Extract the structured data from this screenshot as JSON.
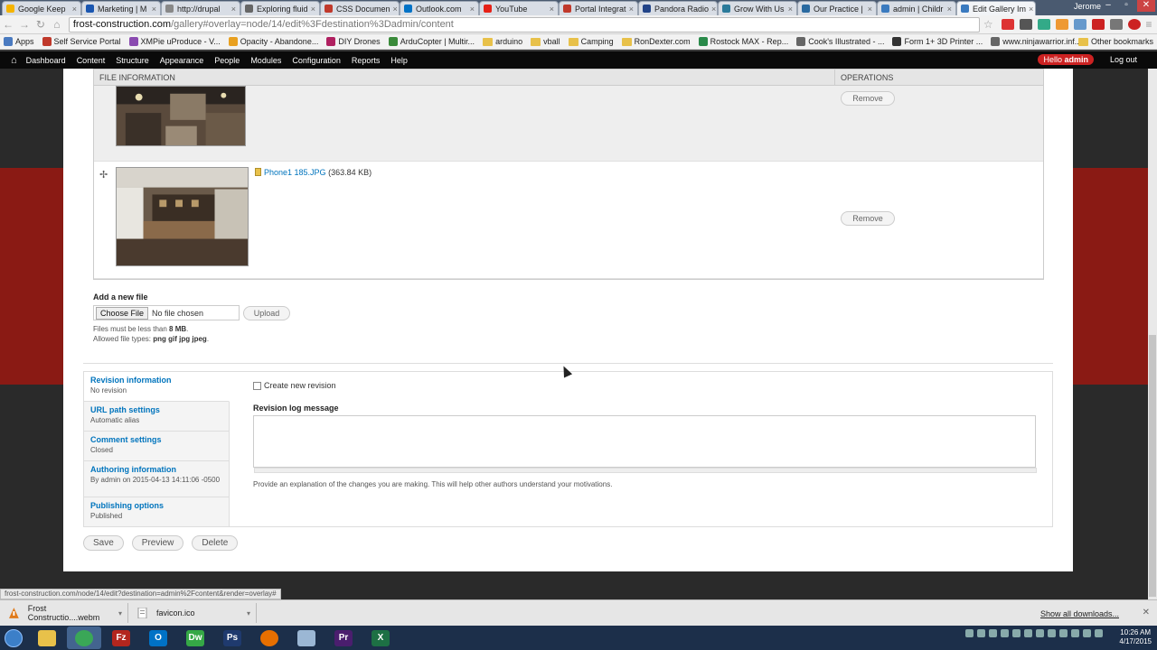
{
  "tabs": [
    {
      "label": "Google Keep",
      "color": "#f5b400"
    },
    {
      "label": "Marketing | M",
      "color": "#1a56b0"
    },
    {
      "label": "http://drupal",
      "color": "#888888"
    },
    {
      "label": "Exploring fluid",
      "color": "#666666"
    },
    {
      "label": "CSS Documen",
      "color": "#c0392b"
    },
    {
      "label": "Outlook.com",
      "color": "#0072c6"
    },
    {
      "label": "YouTube",
      "color": "#e62117"
    },
    {
      "label": "Portal Integrat",
      "color": "#c0392b"
    },
    {
      "label": "Pandora Radio",
      "color": "#224488"
    },
    {
      "label": "Grow With Us",
      "color": "#2a7a9a"
    },
    {
      "label": "Our Practice |",
      "color": "#2a6aa0"
    },
    {
      "label": "admin | Childr",
      "color": "#3a7abf"
    },
    {
      "label": "Edit Gallery Im",
      "color": "#3a7abf"
    }
  ],
  "window_user": "Jerome",
  "url": {
    "host": "frost-construction.com",
    "rest": "/gallery#overlay=node/14/edit%3Fdestination%3Dadmin/content"
  },
  "bookmarks": [
    {
      "label": "Apps",
      "icon": "apps-icon",
      "color": "#4a7ac0"
    },
    {
      "label": "Self Service Portal",
      "icon": "portal-icon",
      "color": "#c0392b"
    },
    {
      "label": "XMPie uProduce - V...",
      "icon": "xmpie-icon",
      "color": "#8a4ab0"
    },
    {
      "label": "Opacity - Abandone...",
      "icon": "opacity-icon",
      "color": "#e8a020"
    },
    {
      "label": "DIY Drones",
      "icon": "drones-icon",
      "color": "#b02060"
    },
    {
      "label": "ArduCopter | Multir...",
      "icon": "arducopter-icon",
      "color": "#3a8a3a"
    },
    {
      "label": "arduino",
      "icon": "folder-icon",
      "color": "#e8c14a"
    },
    {
      "label": "vball",
      "icon": "folder-icon",
      "color": "#e8c14a"
    },
    {
      "label": "Camping",
      "icon": "folder-icon",
      "color": "#e8c14a"
    },
    {
      "label": "RonDexter.com",
      "icon": "folder-icon",
      "color": "#e8c14a"
    },
    {
      "label": "Rostock MAX - Rep...",
      "icon": "rostock-icon",
      "color": "#2a8a4a"
    },
    {
      "label": "Cook's Illustrated - ...",
      "icon": "page-icon",
      "color": "#666666"
    },
    {
      "label": "Form 1+ 3D Printer ...",
      "icon": "form-icon",
      "color": "#333333"
    },
    {
      "label": "www.ninjawarrior.inf...",
      "icon": "page-icon",
      "color": "#666666"
    }
  ],
  "other_bookmarks": "Other bookmarks",
  "admin_menu": [
    "Dashboard",
    "Content",
    "Structure",
    "Appearance",
    "People",
    "Modules",
    "Configuration",
    "Reports",
    "Help"
  ],
  "hello": {
    "prefix": "Hello",
    "user": "admin"
  },
  "logout": "Log out",
  "files": {
    "col_file_info": "FILE INFORMATION",
    "col_operations": "OPERATIONS",
    "rows": [
      {
        "name": "",
        "size": "",
        "remove": "Remove"
      },
      {
        "name": "Phone1 185.JPG",
        "size": "(363.84 KB)",
        "remove": "Remove"
      }
    ]
  },
  "add_file": {
    "title": "Add a new file",
    "choose_label": "Choose File",
    "no_file": "No file chosen",
    "upload": "Upload",
    "limit_prefix": "Files must be less than",
    "limit_value": "8 MB",
    "types_prefix": "Allowed file types:",
    "types_value": "png gif jpg jpeg"
  },
  "vertical_tabs": [
    {
      "title": "Revision information",
      "summary": "No revision"
    },
    {
      "title": "URL path settings",
      "summary": "Automatic alias"
    },
    {
      "title": "Comment settings",
      "summary": "Closed"
    },
    {
      "title": "Authoring information",
      "summary": "By admin on 2015-04-13 14:11:06 -0500"
    },
    {
      "title": "Publishing options",
      "summary": "Published"
    }
  ],
  "revision": {
    "checkbox_label": "Create new revision",
    "checked": false,
    "log_label": "Revision log message",
    "log_value": "",
    "help": "Provide an explanation of the changes you are making. This will help other authors understand your motivations."
  },
  "actions": {
    "save": "Save",
    "preview": "Preview",
    "delete": "Delete"
  },
  "status_url": "frost-construction.com/node/14/edit?destination=admin%2Fcontent&render=overlay#",
  "downloads": [
    {
      "name": "Frost Constructio....webm",
      "icon": "download-file-icon"
    },
    {
      "name": "favicon.ico",
      "icon": "download-file-icon"
    }
  ],
  "show_all_downloads": "Show all downloads...",
  "taskbar_apps": [
    {
      "name": "explorer",
      "color": "#e8c14a",
      "glyph": ""
    },
    {
      "name": "chrome",
      "color": "#3aa757",
      "glyph": ""
    },
    {
      "name": "filezilla",
      "color": "#b3261e",
      "glyph": "Fz"
    },
    {
      "name": "outlook",
      "color": "#0072c6",
      "glyph": "O"
    },
    {
      "name": "dreamweaver",
      "color": "#35a846",
      "glyph": "Dw"
    },
    {
      "name": "photoshop",
      "color": "#1f3a6e",
      "glyph": "Ps"
    },
    {
      "name": "firefox",
      "color": "#e76f00",
      "glyph": ""
    },
    {
      "name": "notepad",
      "color": "#9bb7d4",
      "glyph": ""
    },
    {
      "name": "premiere",
      "color": "#4a1e6e",
      "glyph": "Pr"
    },
    {
      "name": "excel",
      "color": "#1d7044",
      "glyph": "X"
    }
  ],
  "clock": {
    "time": "10:26 AM",
    "date": "4/17/2015"
  }
}
